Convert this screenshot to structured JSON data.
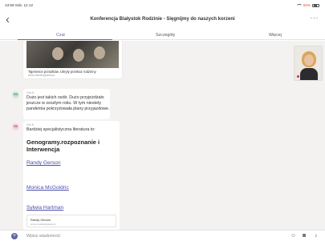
{
  "status_bar": {
    "time": "13:59",
    "date": "Sob. 12.12",
    "battery": "55%"
  },
  "header": {
    "title": "Konferencja Białystok Rodzinie - Sięgnijmy do naszych korzeni",
    "back_icon": "chevron-left-icon",
    "more_icon": "ellipsis-icon"
  },
  "tabs": [
    {
      "label": "Czat",
      "active": true
    },
    {
      "label": "Szczegóły",
      "active": false
    },
    {
      "label": "Więcej",
      "active": false
    }
  ],
  "link_preview": {
    "title": "Tajemnice przodków. Ukryty przekaz rodzinny",
    "url": "www.matrabaypasta.pl"
  },
  "messages": [
    {
      "avatar": "GO",
      "sender": "Grö G",
      "text": "Dużo jest takich osób. Dużo przyjeżdżało jeszcze w zeszłym roku. W tym niestety pandemia pokrzyżowała plany przyjazdowe."
    },
    {
      "avatar": "GK",
      "sender": "Grö K",
      "text": "Bardziej specjalistyczna literatura to:",
      "book_title": "Genogramy.rozpoznanie i Interwencja",
      "authors": [
        "Randy Gerson",
        "Monica McGoldric",
        "Sylwia Hartman"
      ],
      "card": {
        "title": "Randy Gerson",
        "url": "www.matrabaypasta.pl"
      }
    }
  ],
  "compose": {
    "placeholder": "Wpisz wiadomość",
    "plus_icon": "plus-icon",
    "icons": [
      "emoji-icon",
      "camera-icon",
      "microphone-icon"
    ]
  },
  "colors": {
    "accent": "#6264a7",
    "chat_bg": "#f3f2f1",
    "link": "#4b4ea8",
    "battery": "#e0523b"
  }
}
